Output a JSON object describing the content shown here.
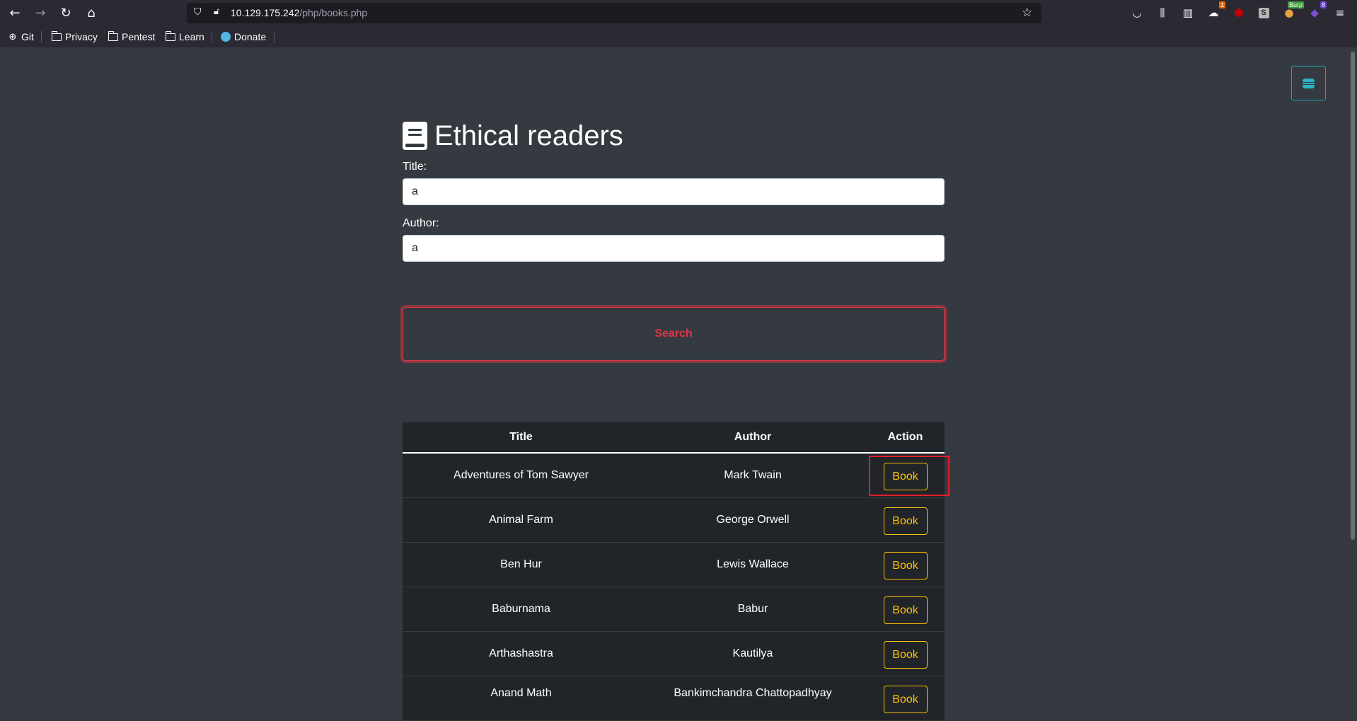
{
  "browser": {
    "url_host": "10.129.175.242",
    "url_path": "/php/books.php",
    "bookmarks": [
      {
        "label": "Git",
        "icon": "globe-icon"
      },
      {
        "label": "Privacy",
        "icon": "folder-icon"
      },
      {
        "label": "Pentest",
        "icon": "folder-icon"
      },
      {
        "label": "Learn",
        "icon": "folder-icon"
      },
      {
        "label": "Donate",
        "icon": "donate-icon"
      }
    ],
    "toolbar_icons": [
      "pocket-icon",
      "library-icon",
      "sidebar-icon",
      "extension-icon",
      "ublock-icon",
      "extension-s-icon",
      "burp-icon",
      "extension-badge-icon",
      "menu-icon"
    ],
    "extension_badges": {
      "first": "1",
      "burp": "Burp",
      "last": "8"
    }
  },
  "page": {
    "heading": "Ethical readers",
    "title_label": "Title:",
    "title_value": "a",
    "author_label": "Author:",
    "author_value": "a",
    "search_label": "Search",
    "colors": {
      "background": "#353a41",
      "danger": "#dc3545",
      "warning": "#ffc107",
      "info": "#1fa2b5",
      "table_bg": "#212529"
    }
  },
  "table": {
    "headers": {
      "title": "Title",
      "author": "Author",
      "action": "Action"
    },
    "rows": [
      {
        "title": "Adventures of Tom Sawyer",
        "author": "Mark Twain",
        "action": "Book"
      },
      {
        "title": "Animal Farm",
        "author": "George Orwell",
        "action": "Book"
      },
      {
        "title": "Ben Hur",
        "author": "Lewis Wallace",
        "action": "Book"
      },
      {
        "title": "Baburnama",
        "author": "Babur",
        "action": "Book"
      },
      {
        "title": "Arthashastra",
        "author": "Kautilya",
        "action": "Book"
      },
      {
        "title": "Anand Math",
        "author": "Bankimchandra Chattopadhyay",
        "action": "Book"
      }
    ]
  }
}
